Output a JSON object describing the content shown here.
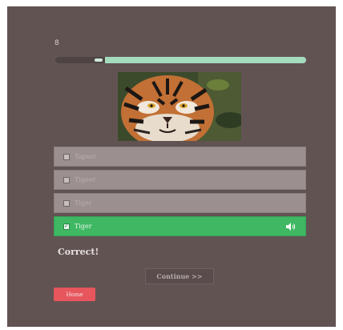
{
  "quiz": {
    "question_counter": "8",
    "progress": 0.2,
    "options": [
      {
        "label": "Tapser",
        "checked": false,
        "correct": false
      },
      {
        "label": "Tigeer",
        "checked": false,
        "correct": false
      },
      {
        "label": "Tiger",
        "checked": false,
        "correct": false
      },
      {
        "label": "Tiger",
        "checked": true,
        "correct": true
      }
    ],
    "feedback": "Correct!",
    "continue_label": "Continue >>",
    "home_label": "Home",
    "icons": {
      "checkbox": "checkbox-icon",
      "check_mark": "✓",
      "audio": "speaker-icon",
      "image": "tiger-photo"
    },
    "colors": {
      "background": "#625353",
      "correct": "#3fb763",
      "progress": "#a5dcbd",
      "home_button": "#e6565c"
    }
  }
}
